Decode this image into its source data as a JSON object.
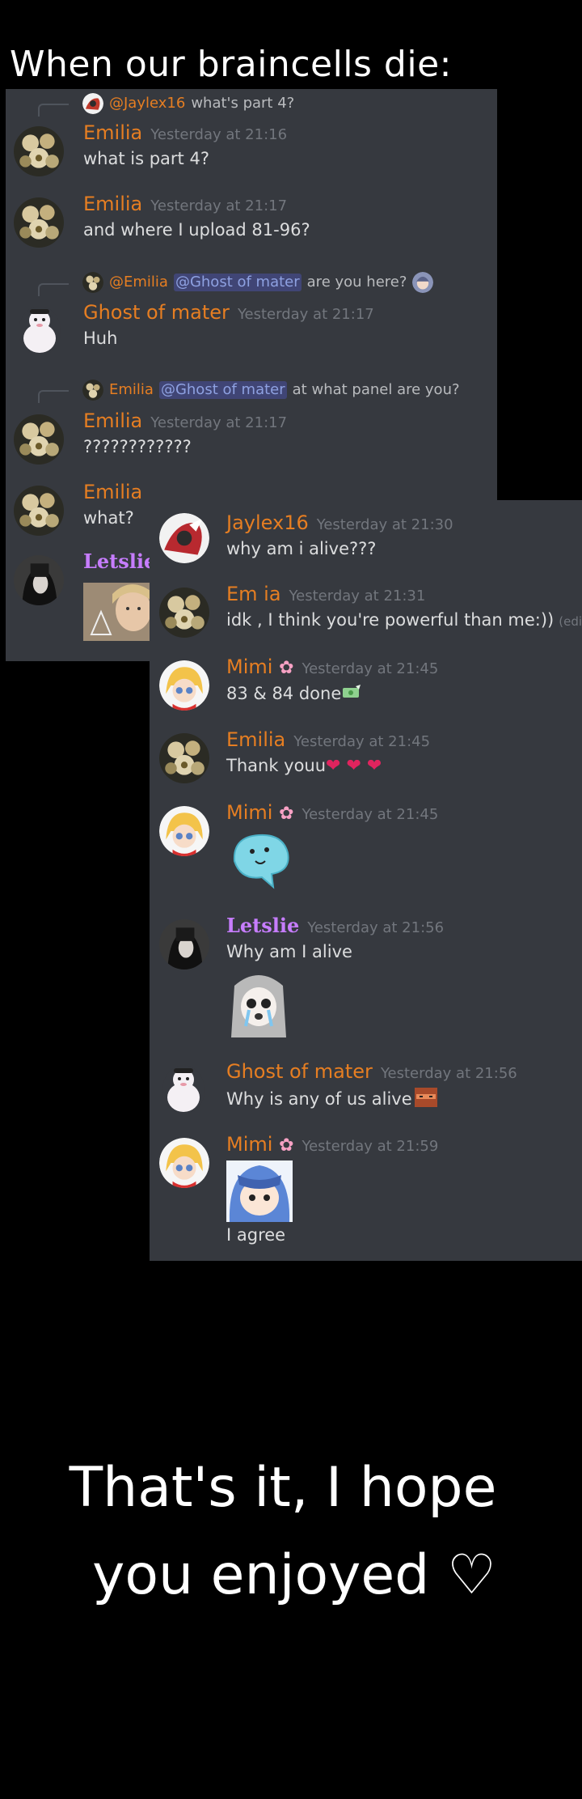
{
  "title": "When our braincells die:",
  "panel_a": {
    "reply_1": {
      "author": "@Jaylex16",
      "text": "what's part 4?"
    },
    "msg_1": {
      "author": "Emilia",
      "time": "Yesterday at 21:16",
      "text": "what is part 4?"
    },
    "msg_2": {
      "author": "Emilia",
      "time": "Yesterday at 21:17",
      "text": "and where I upload 81-96?"
    },
    "reply_2": {
      "author": "@Emilia",
      "mention": "@Ghost of mater",
      "text": "are you here?"
    },
    "msg_3": {
      "author": "Ghost of mater",
      "time": "Yesterday at 21:17",
      "text": "Huh"
    },
    "reply_3": {
      "author": "Emilia",
      "mention": "@Ghost of mater",
      "text": "at what panel are you?"
    },
    "msg_4": {
      "author": "Emilia",
      "time": "Yesterday at 21:17",
      "text": "????????????"
    },
    "msg_5": {
      "author": "Emilia",
      "text": "what?"
    },
    "msg_6": {
      "author": "Letslie"
    }
  },
  "panel_b": {
    "msg_1": {
      "author": "Jaylex16",
      "time": "Yesterday at 21:30",
      "text": "why am i alive???"
    },
    "msg_2": {
      "author": "Em  ia",
      "time": "Yesterday at 21:31",
      "text": "idk , I think you're powerful than me:))",
      "edited": "(edited)"
    },
    "msg_3": {
      "author": "Mimi",
      "time": "Yesterday at 21:45",
      "text": "83 & 84 done"
    },
    "msg_4": {
      "author": "Emilia",
      "time": "Yesterday at 21:45",
      "text": "Thank youu"
    },
    "msg_5": {
      "author": "Mimi",
      "time": "Yesterday at 21:45"
    },
    "msg_6": {
      "author": "Letslie",
      "time": "Yesterday at 21:56",
      "text": "Why am I alive"
    },
    "msg_7": {
      "author": "Ghost of mater",
      "time": "Yesterday at 21:56",
      "text": "Why is any of us alive"
    },
    "msg_8": {
      "author": "Mimi",
      "time": "Yesterday at 21:59",
      "text": "I agree"
    }
  },
  "ending": {
    "line1": "That's it, I hope",
    "line2": "you enjoyed ♡"
  },
  "colors": {
    "panel_bg": "#36393f",
    "username_orange": "#e67e22",
    "username_purple": "#c77dff",
    "timestamp": "#72767d",
    "mention": "#8ea1e1"
  },
  "icons": [
    "flower-avatar-icon",
    "ghost-avatar-icon",
    "anime-avatar-icon",
    "flower-badge-icon",
    "money-emoji-icon",
    "heart-emoji-icon",
    "blob-sticker-icon",
    "crying-sticker-icon",
    "chibi-sticker-icon"
  ]
}
